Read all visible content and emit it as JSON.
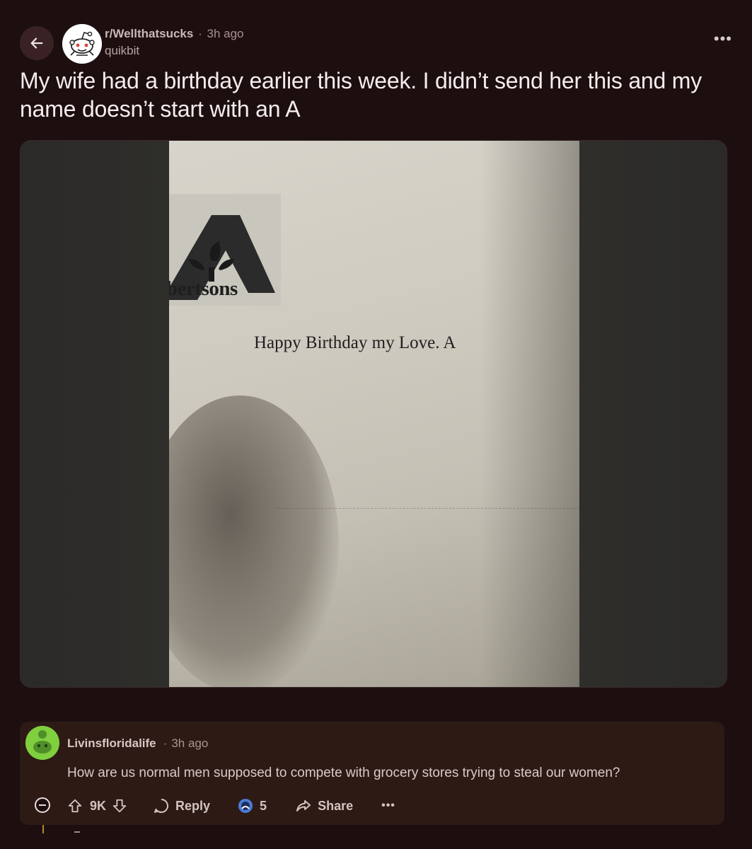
{
  "post": {
    "subreddit": "r/Wellthatsucks",
    "separator": "·",
    "time": "3h ago",
    "username": "quikbit",
    "more_label": "•••",
    "title": "My wife had a birthday earlier this week. I didn’t send her this and my name doesn’t start with an A",
    "image": {
      "logo_text": "bertsons",
      "card_text": "Happy Birthday my Love. A"
    }
  },
  "comment": {
    "author": "Livinsfloridalife",
    "separator": "·",
    "time": "3h ago",
    "body": "How are us normal men supposed to compete with grocery stores trying to steal our women?",
    "score": "9K",
    "reply_label": "Reply",
    "award_count": "5",
    "share_label": "Share",
    "more_label": "•••"
  },
  "colors": {
    "background": "#1d0f10",
    "comment_bg": "#2d1a15",
    "thread_line": "#b38a24",
    "avatar_green": "#7fcf3f"
  },
  "icons": [
    "back-arrow-icon",
    "reddit-snoo-icon",
    "more-options-icon",
    "upvote-icon",
    "downvote-icon",
    "reply-bubble-icon",
    "award-icon",
    "share-arrow-icon",
    "collapse-icon"
  ]
}
